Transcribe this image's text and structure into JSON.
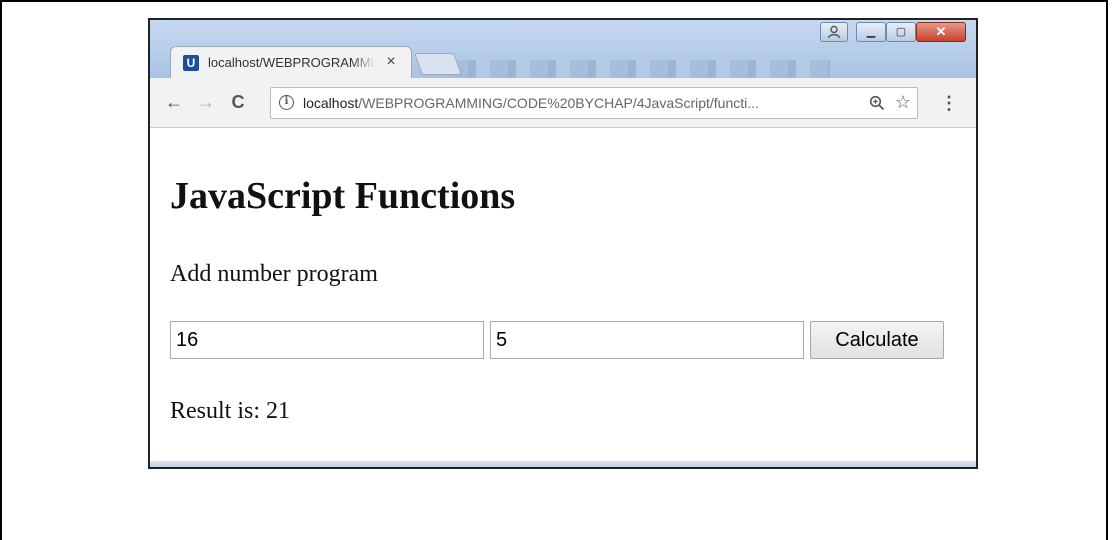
{
  "browser": {
    "tab": {
      "title": "localhost/WEBPROGRAMMING",
      "favicon": "U",
      "close_icon": "close-icon"
    },
    "window_controls": {
      "user": "person-icon",
      "minimize": "minimize-icon",
      "maximize": "maximize-icon",
      "close": "close-icon"
    },
    "toolbar": {
      "back_icon": "back-arrow-icon",
      "forward_icon": "forward-arrow-icon",
      "reload_icon": "reload-icon",
      "url_host": "localhost",
      "url_path": "/WEBPROGRAMMING/CODE%20BYCHAP/4JavaScript/functi...",
      "info_icon": "info-icon",
      "zoom_icon": "zoom-icon",
      "bookmark_icon": "star-icon",
      "menu_icon": "menu-dots-icon"
    }
  },
  "page": {
    "heading": "JavaScript Functions",
    "subtitle": "Add number program",
    "input_a": "16",
    "input_b": "5",
    "calculate_label": "Calculate",
    "result_label": "Result is:",
    "result_value": "21"
  }
}
